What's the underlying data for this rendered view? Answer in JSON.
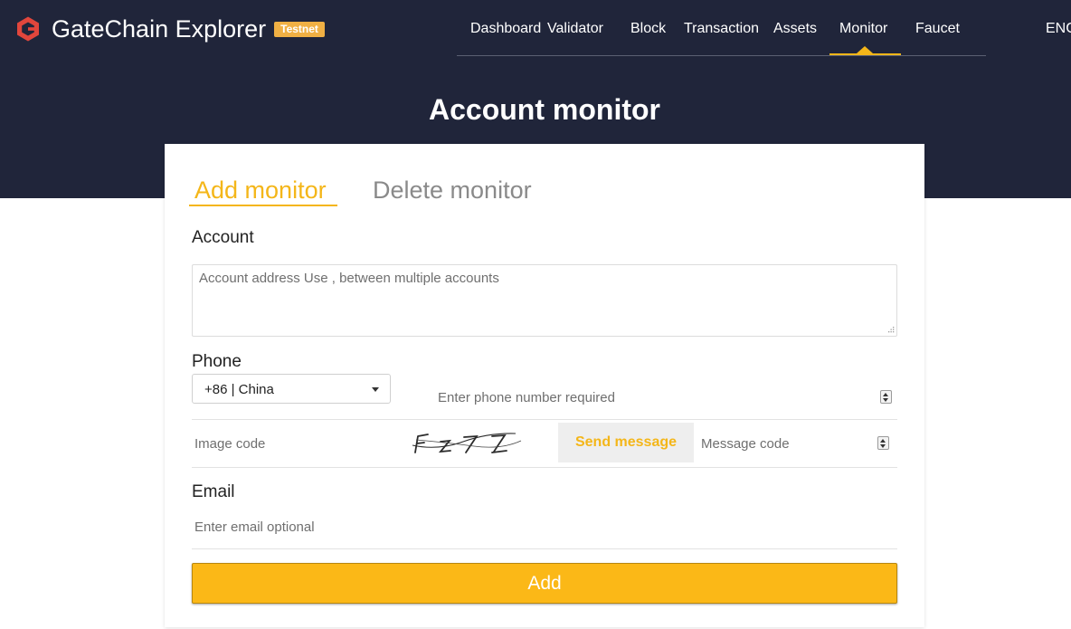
{
  "brand": {
    "name": "GateChain Explorer",
    "badge": "Testnet",
    "logo_icon": "gatechain-logo-icon"
  },
  "nav": {
    "items": [
      "Dashboard",
      "Validator",
      "Block",
      "Transaction",
      "Assets",
      "Monitor",
      "Faucet"
    ],
    "active": "Monitor",
    "language": "ENG"
  },
  "page": {
    "title": "Account monitor"
  },
  "tabs": {
    "add": "Add monitor",
    "delete": "Delete monitor",
    "active": "Add monitor"
  },
  "form": {
    "account": {
      "label": "Account",
      "placeholder": "Account address Use , between multiple accounts",
      "value": ""
    },
    "phone": {
      "label": "Phone",
      "country_code": "+86 | China",
      "placeholder": "Enter phone number required",
      "image_code_placeholder": "Image code",
      "captcha_text": "FZ7Z",
      "send_label": "Send message",
      "message_code_placeholder": "Message code"
    },
    "email": {
      "label": "Email",
      "placeholder": "Enter email optional"
    },
    "submit_label": "Add"
  },
  "colors": {
    "header_bg": "#20253a",
    "accent": "#f4b619",
    "button": "#fbb817",
    "badge": "#f0b044"
  }
}
